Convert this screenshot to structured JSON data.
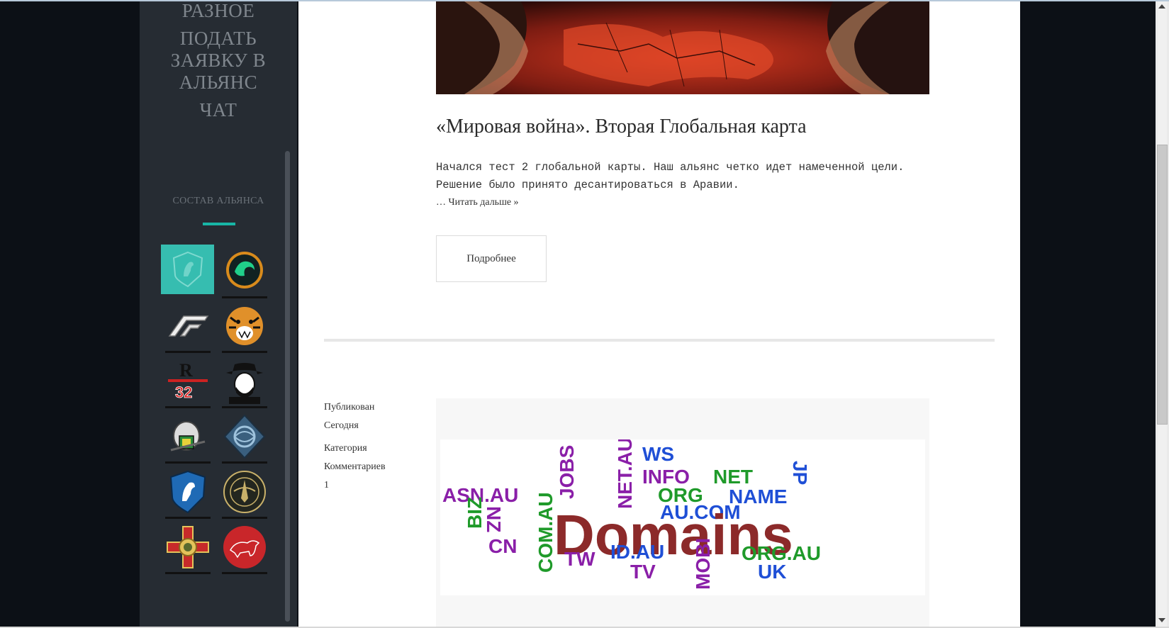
{
  "sidebar": {
    "menu": [
      "РАЗНОЕ",
      "ПОДАТЬ ЗАЯВКУ В АЛЬЯНС",
      "ЧАТ"
    ],
    "section_title": "СОСТАВ АЛЬЯНСА",
    "clan_icons": [
      "white-horse-shield-icon",
      "green-phoenix-emblem-icon",
      "nfs-logo-icon",
      "tiger-head-icon",
      "r32-emblem-icon",
      "cowboy-portrait-icon",
      "armored-rat-emblem-icon",
      "blue-knot-emblem-icon",
      "blue-horse-shield-icon",
      "brotherhood-of-steel-emblem-icon",
      "red-cross-order-icon",
      "red-bull-circle-icon"
    ]
  },
  "post": {
    "title": "«Мировая война». Вторая Глобальная карта",
    "text_line1": "Начался тест 2 глобальной карты. Наш альянс четко идет намеченной цели.",
    "text_line2": "Решение было принято десантироваться в Аравии.",
    "read_more": "… Читать дальше »",
    "details_button": "Подробнее"
  },
  "meta": {
    "published_label": "Публикован",
    "published_value": "Сегодня",
    "category_label": "Категория",
    "comments_label": "Комментариев",
    "comments_value": "1"
  },
  "word_cloud": {
    "main_word": "Domains",
    "words": [
      "WS",
      "INFO",
      "NET",
      "JP",
      "ASN.AU",
      "JOBS",
      "NET.AU",
      "ORG",
      "NAME",
      "AU.COM",
      "BIZ",
      "NZ",
      "COM.AU",
      "CN",
      "TW",
      "ID.AU",
      "TV",
      "MOBI",
      "ORG.AU",
      "UK"
    ]
  },
  "colors": {
    "accent": "#18b6a6",
    "sidebar_bg": "#262c33",
    "page_bg": "#0c1016"
  }
}
